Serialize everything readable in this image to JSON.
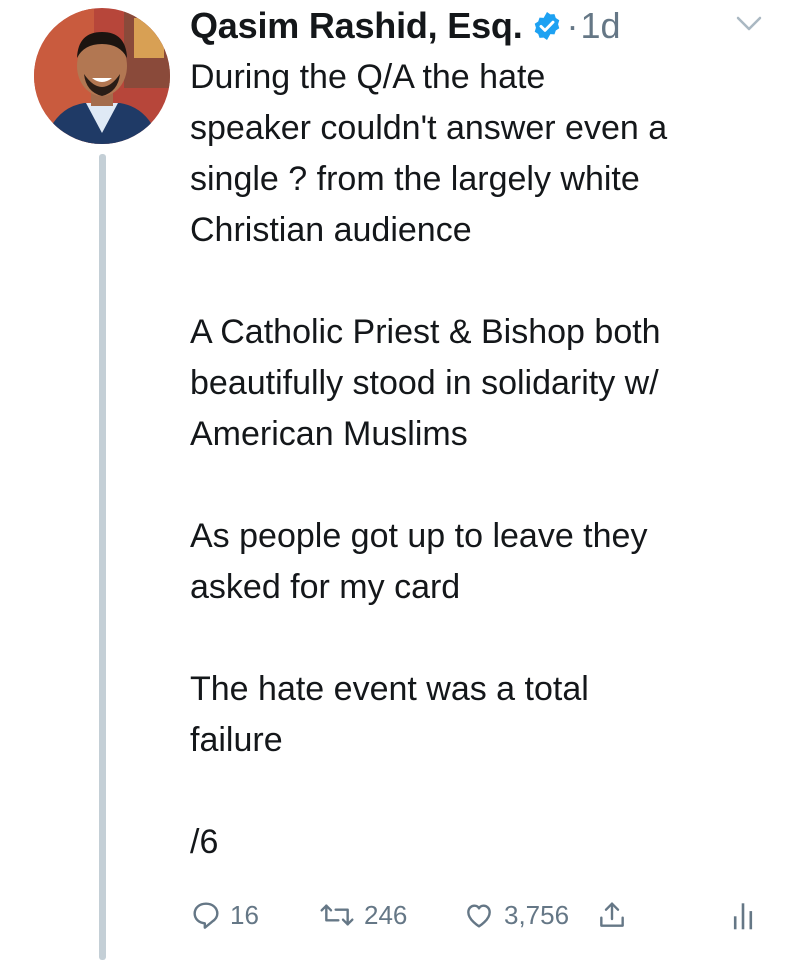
{
  "tweet": {
    "author": {
      "display_name": "Qasim Rashid, Esq.",
      "verified": true,
      "avatar_icon": "profile-photo"
    },
    "separator": "·",
    "time": "1d",
    "paragraphs": [
      "During the Q/A the hate\nspeaker couldn't answer even a\nsingle ? from the largely white\nChristian audience",
      "A Catholic Priest & Bishop both\nbeautifully stood in solidarity w/\nAmerican Muslims",
      "As people got up to leave they\nasked for my card",
      "The hate event was a total\nfailure",
      "/6"
    ],
    "actions": {
      "replies": "16",
      "retweets": "246",
      "likes": "3,756"
    }
  },
  "colors": {
    "text": "#14171a",
    "muted": "#657786",
    "verified_blue": "#1da1f2",
    "thread_line": "#c4cfd6"
  },
  "icons": [
    "chevron-down-icon",
    "verified-badge-icon",
    "reply-icon",
    "retweet-icon",
    "like-icon",
    "share-icon",
    "analytics-icon"
  ]
}
